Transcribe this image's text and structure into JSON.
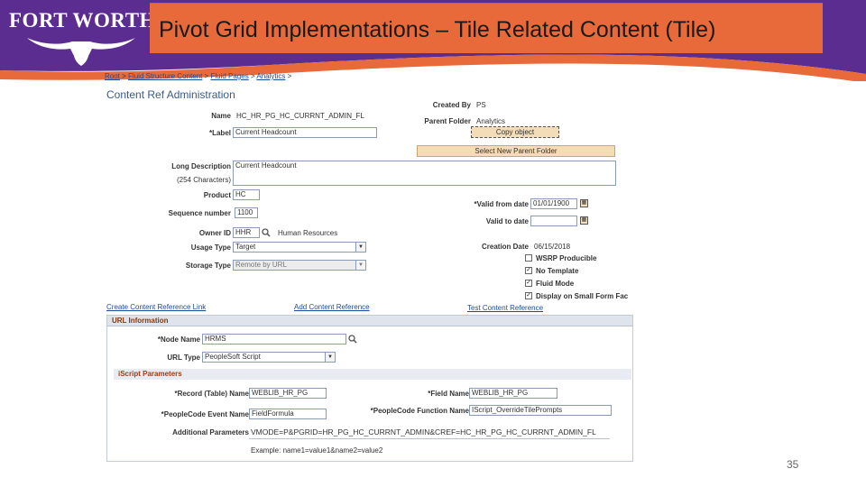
{
  "slide": {
    "logo_text": "FORT WORTH",
    "title": "Pivot Grid Implementations – Tile Related Content (Tile)",
    "page_number": "35"
  },
  "colors": {
    "purple": "#5c2d91",
    "orange": "#e8693a",
    "link": "#1a4c9c"
  },
  "ps": {
    "breadcrumb": [
      "Root",
      "Fluid Structure Content",
      "Fluid Pages",
      "Analytics"
    ],
    "breadcrumb_sep": ">",
    "page_title": "Content Ref Administration",
    "name_label": "Name",
    "name_value": "HC_HR_PG_HC_CURRNT_ADMIN_FL",
    "label_label": "*Label",
    "label_value": "Current Headcount",
    "long_desc_label": "Long Description",
    "long_desc_sub": "(254 Characters)",
    "long_desc_value": "Current Headcount",
    "product_label": "Product",
    "product_value": "HC",
    "sequence_label": "Sequence number",
    "sequence_value": "1100",
    "owner_label": "Owner ID",
    "owner_value": "HHR",
    "owner_desc": "Human Resources",
    "usage_label": "Usage Type",
    "usage_value": "Target",
    "storage_label": "Storage Type",
    "storage_value": "Remote by URL",
    "created_by_label": "Created By",
    "created_by_value": "PS",
    "parent_folder_label": "Parent Folder",
    "parent_folder_value": "Analytics",
    "copy_object_btn": "Copy object",
    "select_parent_btn": "Select New Parent Folder",
    "valid_from_label": "*Valid from date",
    "valid_from_value": "01/01/1900",
    "valid_to_label": "Valid to date",
    "valid_to_value": "",
    "creation_date_label": "Creation Date",
    "creation_date_value": "06/15/2018",
    "checkboxes": [
      {
        "label": "WSRP Producible",
        "checked": false
      },
      {
        "label": "No Template",
        "checked": true
      },
      {
        "label": "Fluid Mode",
        "checked": true
      },
      {
        "label": "Display on Small Form Fac",
        "checked": true
      }
    ],
    "links": {
      "create_link": "Create Content Reference Link",
      "add_ref": "Add Content Reference",
      "test_ref": "Test Content Reference"
    },
    "url_section_title": "URL Information",
    "node_name_label": "*Node Name",
    "node_name_value": "HRMS",
    "url_type_label": "URL Type",
    "url_type_value": "PeopleSoft Script",
    "iscript_title": "iScript Parameters",
    "record_label": "*Record (Table) Name",
    "record_value": "WEBLIB_HR_PG",
    "field_label": "*Field Name",
    "field_value": "WEBLIB_HR_PG",
    "pc_event_label": "*PeopleCode Event Name",
    "pc_event_value": "FieldFormula",
    "pc_function_label": "*PeopleCode Function Name",
    "pc_function_value": "IScript_OverrideTilePrompts",
    "addl_params_label": "Additional Parameters",
    "addl_params_value": "VMODE=P&PGRID=HR_PG_HC_CURRNT_ADMIN&CREF=HC_HR_PG_HC_CURRNT_ADMIN_FL",
    "example_text": "Example: name1=value1&name2=value2"
  }
}
